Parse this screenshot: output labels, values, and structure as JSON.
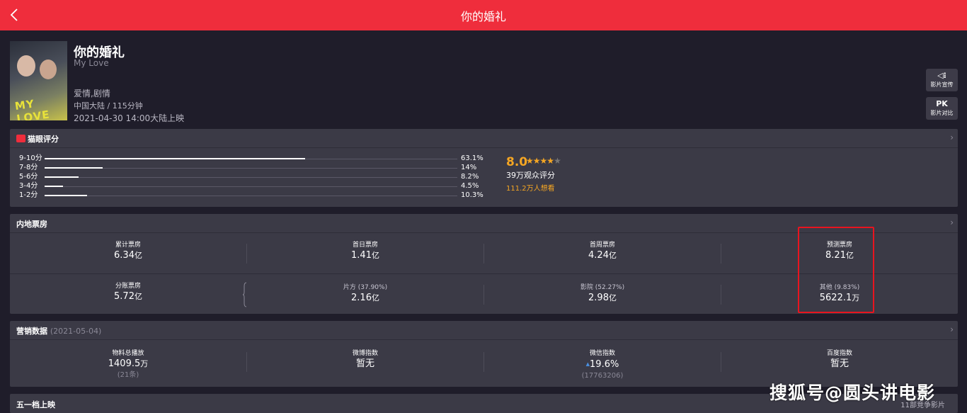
{
  "header": {
    "title": "你的婚礼"
  },
  "movie": {
    "title": "你的婚礼",
    "subtitle": "My Love",
    "genre": "爱情,剧情",
    "region_duration": "中国大陆 / 115分钟",
    "release": "2021-04-30 14:00大陆上映",
    "poster_text": "MY LOVE"
  },
  "side_buttons": [
    {
      "icon": "◁⁝",
      "label": "影片宣传"
    },
    {
      "icon": "PK",
      "label": "影片对比"
    }
  ],
  "rating": {
    "title": "猫眼评分",
    "rows": [
      {
        "label": "9-10分",
        "percent": "63.1%",
        "value": 63.1
      },
      {
        "label": "7-8分",
        "percent": "14%",
        "value": 14
      },
      {
        "label": "5-6分",
        "percent": "8.2%",
        "value": 8.2
      },
      {
        "label": "3-4分",
        "percent": "4.5%",
        "value": 4.5
      },
      {
        "label": "1-2分",
        "percent": "10.3%",
        "value": 10.3
      }
    ],
    "score": "8.0",
    "stars_filled": 4,
    "stars_total": 5,
    "count_text": "39万观众评分",
    "want_text": "111.2万人想看",
    "accent_color": "#f5a623"
  },
  "box_office": {
    "title": "内地票房",
    "row1": [
      {
        "label": "累计票房",
        "value": "6.34",
        "unit": "亿"
      },
      {
        "label": "首日票房",
        "value": "1.41",
        "unit": "亿"
      },
      {
        "label": "首周票房",
        "value": "4.24",
        "unit": "亿"
      },
      {
        "label": "预测票房",
        "value": "8.21",
        "unit": "亿"
      }
    ],
    "row2": [
      {
        "label": "分账票房",
        "value": "5.72",
        "unit": "亿"
      },
      {
        "label": "片方 (37.90%)",
        "value": "2.16",
        "unit": "亿"
      },
      {
        "label": "影院 (52.27%)",
        "value": "2.98",
        "unit": "亿"
      },
      {
        "label": "其他 (9.83%)",
        "value": "5622.1",
        "unit": "万"
      }
    ]
  },
  "marketing": {
    "title": "营销数据",
    "date": "(2021-05-04)",
    "cells": [
      {
        "label": "物料总播放",
        "value": "1409.5",
        "unit": "万",
        "sub": "(21条)"
      },
      {
        "label": "微博指数",
        "value": "暂无",
        "unit": "",
        "sub": ""
      },
      {
        "label": "微信指数",
        "value": "19.6%",
        "unit": "",
        "sub": "(17763206)",
        "arrow": "▲"
      },
      {
        "label": "百度指数",
        "value": "暂无",
        "unit": "",
        "sub": ""
      }
    ]
  },
  "holiday": {
    "title": "五一档上映",
    "right_text": "11部竞争影片"
  },
  "watermark": "搜狐号@圆头讲电影",
  "colors": {
    "topbar": "#ef2d3c",
    "background": "#1f1d2a",
    "panel": "#3b3a46",
    "highlight_box": "#e8141f"
  }
}
